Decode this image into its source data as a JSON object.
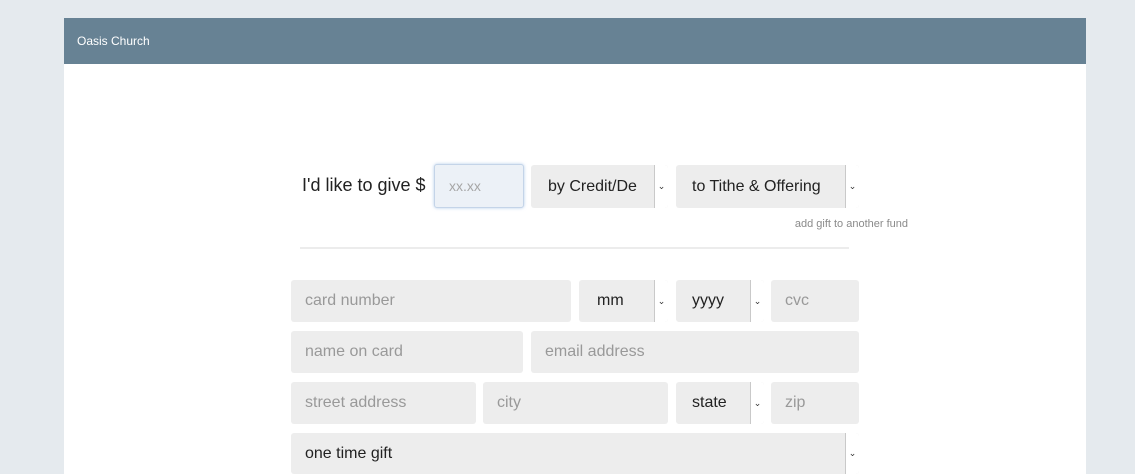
{
  "header": {
    "org_name": "Oasis Church"
  },
  "give": {
    "label": "I'd like to give $",
    "amount_placeholder": "xx.xx",
    "payment_method": "by Credit/De",
    "fund": "to Tithe & Offering",
    "add_fund_link": "add gift to another fund"
  },
  "card": {
    "number_placeholder": "card number",
    "month": "mm",
    "year": "yyyy",
    "cvc_placeholder": "cvc",
    "name_placeholder": "name on card",
    "email_placeholder": "email address",
    "street_placeholder": "street address",
    "city_placeholder": "city",
    "state": "state",
    "zip_placeholder": "zip"
  },
  "frequency": {
    "selected": "one time gift"
  },
  "icons": {
    "select_caret": "chevron-down-icon"
  }
}
